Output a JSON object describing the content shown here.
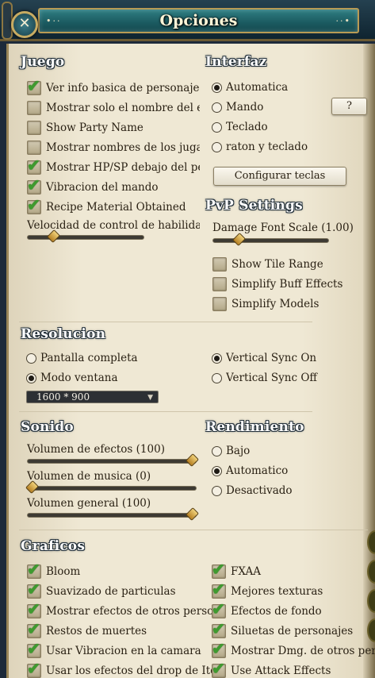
{
  "window": {
    "title": "Opciones",
    "close_icon": "close-icon"
  },
  "juego": {
    "header": "Juego",
    "items": [
      {
        "label": "Ver info basica de personaje",
        "checked": true
      },
      {
        "label": "Mostrar solo el nombre del equ",
        "checked": false
      },
      {
        "label": "Show Party Name",
        "checked": false
      },
      {
        "label": "Mostrar nombres de los jugado:",
        "checked": false
      },
      {
        "label": "Mostrar HP/SP debajo del perso",
        "checked": true
      },
      {
        "label": "Vibracion del mando",
        "checked": true
      },
      {
        "label": "Recipe Material Obtained",
        "checked": true
      }
    ],
    "slider_label": "Velocidad de control de habilidad (",
    "slider_value": 0.2
  },
  "interfaz": {
    "header": "Interfaz",
    "options": [
      {
        "label": "Automatica",
        "selected": true
      },
      {
        "label": "Mando",
        "selected": false
      },
      {
        "label": "Teclado",
        "selected": false
      },
      {
        "label": "raton y teclado",
        "selected": false
      }
    ],
    "help_label": "?",
    "config_button": "Configurar teclas"
  },
  "pvp": {
    "header": "PvP Settings",
    "slider_label": "Damage Font Scale (1.00)",
    "slider_value": 0.2,
    "items": [
      {
        "label": "Show Tile Range",
        "checked": false
      },
      {
        "label": "Simplify Buff Effects",
        "checked": false
      },
      {
        "label": "Simplify Models",
        "checked": false
      }
    ]
  },
  "resolucion": {
    "header": "Resolucion",
    "modes": [
      {
        "label": "Pantalla completa",
        "selected": false
      },
      {
        "label": "Modo ventana",
        "selected": true
      }
    ],
    "vsync": [
      {
        "label": "Vertical Sync On",
        "selected": true
      },
      {
        "label": "Vertical Sync Off",
        "selected": false
      }
    ],
    "resolution_value": "1600 * 900"
  },
  "sonido": {
    "header": "Sonido",
    "sliders": [
      {
        "label": "Volumen de efectos (100)",
        "value": 1.0
      },
      {
        "label": "Volumen de musica (0)",
        "value": 0.0
      },
      {
        "label": "Volumen general (100)",
        "value": 1.0
      }
    ]
  },
  "rendimiento": {
    "header": "Rendimiento",
    "options": [
      {
        "label": "Bajo",
        "selected": false
      },
      {
        "label": "Automatico",
        "selected": true
      },
      {
        "label": "Desactivado",
        "selected": false
      }
    ]
  },
  "graficos": {
    "header": "Graficos",
    "left": [
      {
        "label": "Bloom",
        "checked": true
      },
      {
        "label": "Suavizado de particulas",
        "checked": true
      },
      {
        "label": "Mostrar efectos de otros personajes",
        "checked": true
      },
      {
        "label": "Restos de muertes",
        "checked": true
      },
      {
        "label": "Usar Vibracion en la camara",
        "checked": true
      },
      {
        "label": "Usar los efectos del drop de Item",
        "checked": true
      }
    ],
    "right": [
      {
        "label": "FXAA",
        "checked": true
      },
      {
        "label": "Mejores texturas",
        "checked": true
      },
      {
        "label": "Efectos de fondo",
        "checked": true
      },
      {
        "label": "Siluetas de personajes",
        "checked": true
      },
      {
        "label": "Mostrar Dmg. de otros personajes",
        "checked": true
      },
      {
        "label": "Use Attack Effects",
        "checked": true
      }
    ]
  },
  "colors": {
    "check": "#3f9a2f",
    "panel": "#efe8d4",
    "header_bar": "#1b5a60"
  }
}
